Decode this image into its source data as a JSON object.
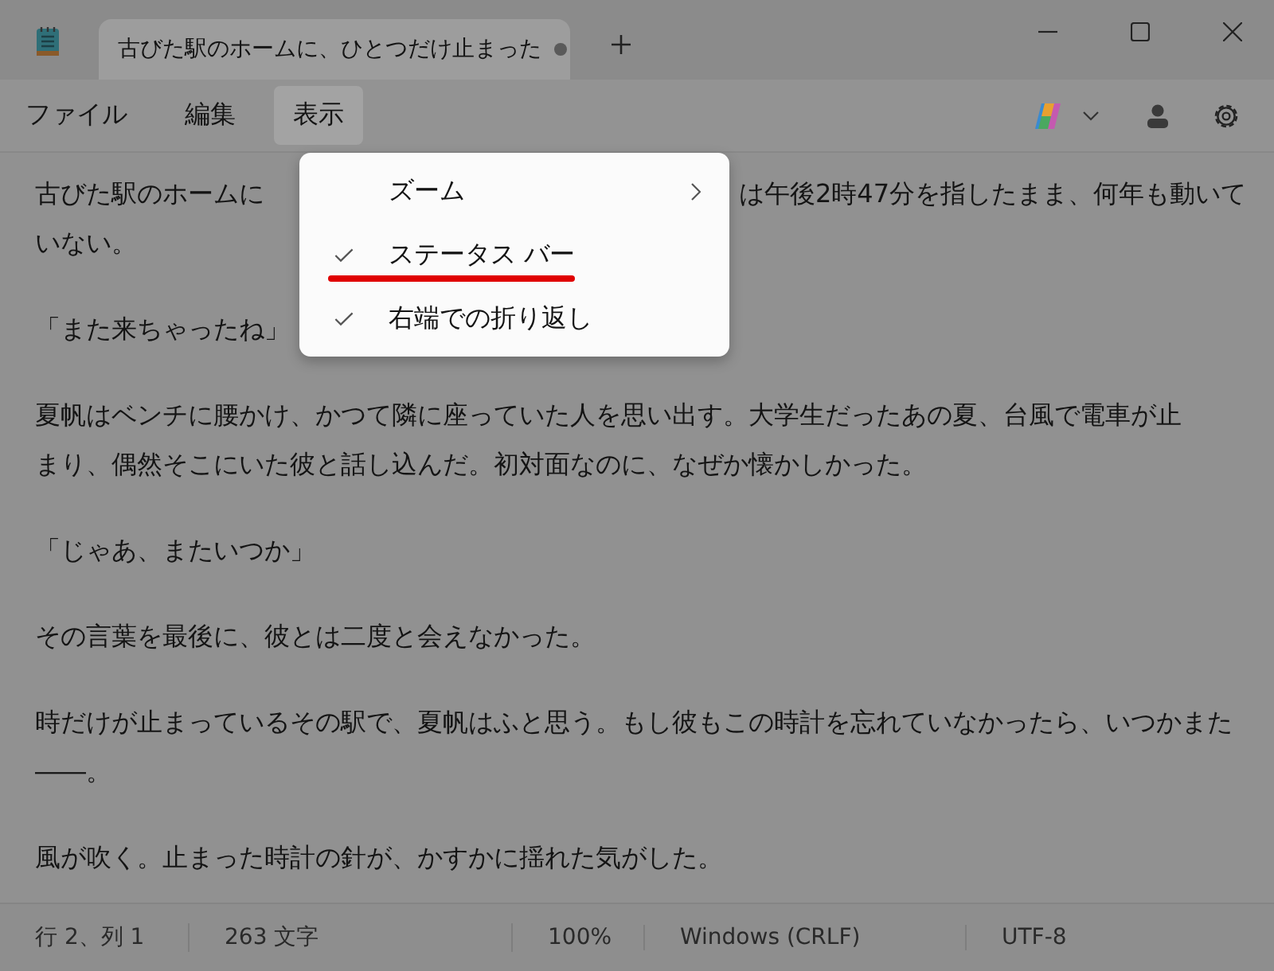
{
  "tab": {
    "title": "古びた駅のホームに、ひとつだけ止まった",
    "modified": true,
    "selected": true
  },
  "menubar": [
    {
      "label": "ファイル",
      "selected": false
    },
    {
      "label": "編集",
      "selected": false
    },
    {
      "label": "表示",
      "selected": true
    }
  ],
  "view_menu": [
    {
      "label": "ズーム",
      "kind": "submenu",
      "underline": false
    },
    {
      "label": "ステータス バー",
      "kind": "check",
      "checked": true,
      "underline": true
    },
    {
      "label": "右端での折り返し",
      "kind": "check",
      "checked": true,
      "underline": false
    }
  ],
  "editor": {
    "first_line_left": "古びた駅のホームに",
    "first_line_right": "は午後2時47分を指したまま、何年も動いて",
    "paragraphs": [
      [
        "いない。"
      ],
      [
        "「また来ちゃったね」"
      ],
      [
        "夏帆はベンチに腰かけ、かつて隣に座っていた人を思い出す。大学生だったあの夏、台風で電車が止",
        "まり、偶然そこにいた彼と話し込んだ。初対面なのに、なぜか懐かしかった。"
      ],
      [
        "「じゃあ、またいつか」"
      ],
      [
        "その言葉を最後に、彼とは二度と会えなかった。"
      ],
      [
        "時だけが止まっているその駅で、夏帆はふと思う。もし彼もこの時計を忘れていなかったら、いつかまた",
        "――。"
      ],
      [
        "風が吹く。止まった時計の針が、かすかに揺れた気がした。"
      ]
    ]
  },
  "status_bar": [
    "行 2、列 1",
    "263 文字",
    "100%",
    "Windows (CRLF)",
    "UTF-8"
  ]
}
